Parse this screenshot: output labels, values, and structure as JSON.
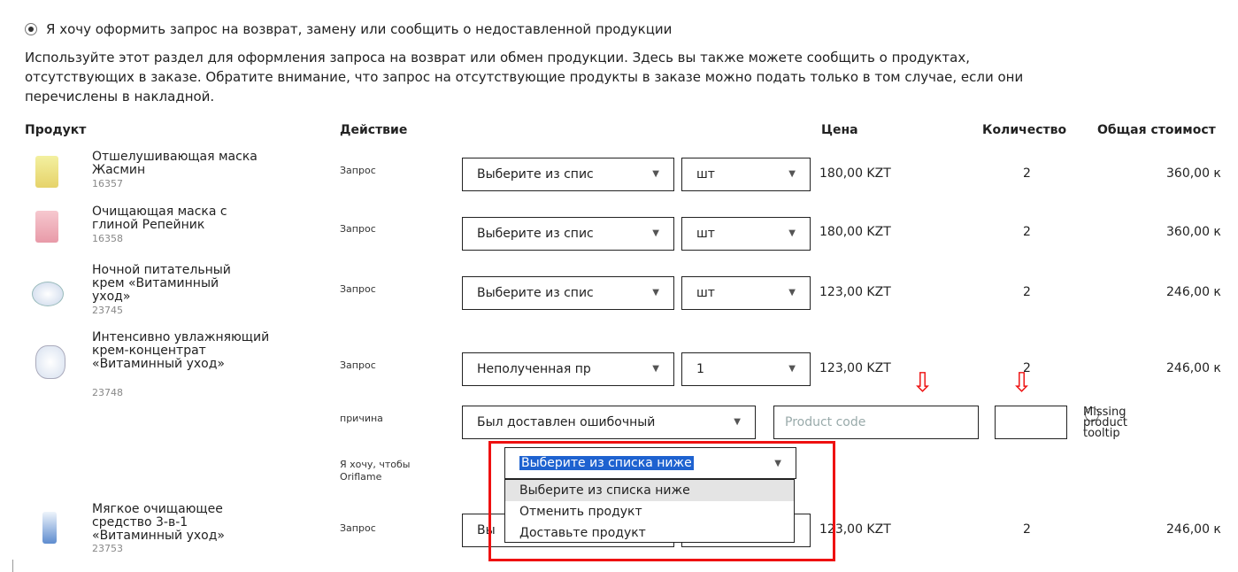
{
  "radio_label": "Я хочу оформить запрос на возврат, замену или сообщить о недоставленной продукции",
  "intro": [
    "Используйте этот раздел для оформления запроса на возврат или обмен продукции. Здесь вы также можете сообщить о продуктах,",
    "отсутствующих в заказе. Обратите внимание, что запрос на отсутствующие продукты в заказе можно подать только в том случае, если они",
    "перечислены в накладной."
  ],
  "headers": {
    "product": "Продукт",
    "action": "Действие",
    "price": "Цена",
    "qty": "Количество",
    "total": "Общая стоимост"
  },
  "rows": [
    {
      "name": "Отшелушивающая маска Жасмин",
      "code": "16357",
      "action": "Запрос",
      "select": "Выберите из спис",
      "unit": "шт",
      "price": "180,00 KZT",
      "qty": "2",
      "total": "360,00 к"
    },
    {
      "name": "Очищающая маска с глиной Репейник",
      "code": "16358",
      "action": "Запрос",
      "select": "Выберите из спис",
      "unit": "шт",
      "price": "180,00 KZT",
      "qty": "2",
      "total": "360,00 к"
    },
    {
      "name": "Ночной питательный крем «Витаминный уход»",
      "code": "23745",
      "action": "Запрос",
      "select": "Выберите из спис",
      "unit": "шт",
      "price": "123,00 KZT",
      "qty": "2",
      "total": "246,00 к"
    },
    {
      "name": "Интенсивно увлажняющий крем-концентрат «Витаминный уход»",
      "code": "23748",
      "action": "Запрос",
      "select": "Неполученная пр",
      "unit": "1",
      "price": "123,00 KZT",
      "qty": "2",
      "total": "246,00 к"
    },
    {
      "name": "Мягкое очищающее средство 3-в-1 «Витаминный уход»",
      "code": "23753",
      "action": "Запрос",
      "select": "Вы",
      "unit": "",
      "price": "123,00 KZT",
      "qty": "2",
      "total": "246,00 к"
    }
  ],
  "reason": {
    "label": "причина",
    "select": "Был доставлен ошибочный",
    "product_code_placeholder": "Product code",
    "tooltip": "Missing product tooltip"
  },
  "want": {
    "label": "Я хочу, чтобы Oriflame",
    "select": "Выберите из списка ниже",
    "options": [
      "Выберите из списка ниже",
      "Отменить продукт",
      "Доставьте продукт"
    ]
  },
  "icons": {
    "arrow": "⇩",
    "caret": "▼"
  },
  "colors": {
    "annotation_red": "#e11111",
    "selection_blue": "#1e62d0"
  }
}
